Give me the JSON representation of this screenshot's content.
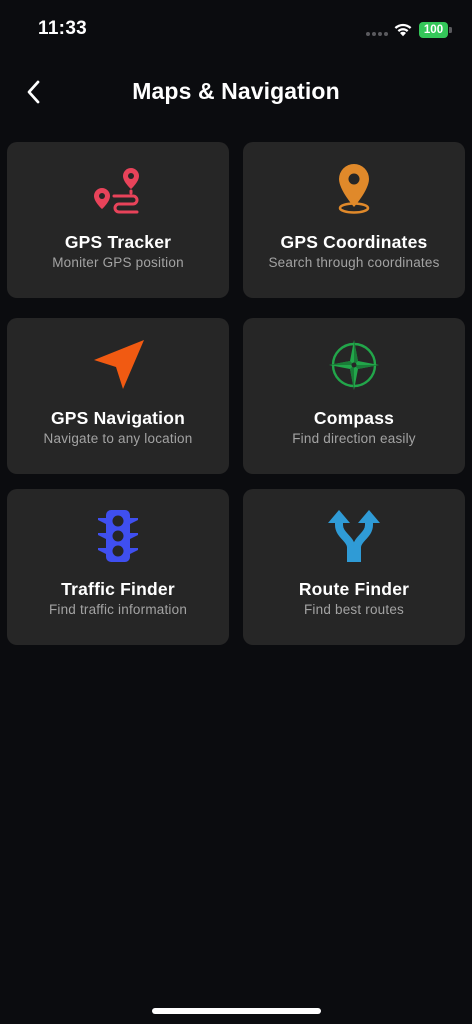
{
  "status_bar": {
    "time": "11:33",
    "battery_level": "100",
    "battery_color": "#34c759"
  },
  "header": {
    "title": "Maps & Navigation",
    "back_icon": "chevron-left-icon"
  },
  "cards": [
    {
      "title": "GPS Tracker",
      "subtitle": "Moniter GPS position",
      "icon": "route-pins-icon",
      "icon_color": "#e8435a"
    },
    {
      "title": "GPS Coordinates",
      "subtitle": "Search through coordinates",
      "icon": "location-pin-icon",
      "icon_color": "#e0892a"
    },
    {
      "title": "GPS Navigation",
      "subtitle": "Navigate to any location",
      "icon": "navigation-arrow-icon",
      "icon_color": "#f15a12"
    },
    {
      "title": "Compass",
      "subtitle": "Find direction easily",
      "icon": "compass-icon",
      "icon_color": "#22a64a"
    },
    {
      "title": "Traffic Finder",
      "subtitle": "Find traffic information",
      "icon": "traffic-light-icon",
      "icon_color": "#3f4ff0"
    },
    {
      "title": "Route Finder",
      "subtitle": "Find best routes",
      "icon": "route-split-icon",
      "icon_color": "#2f9bd6"
    }
  ],
  "colors": {
    "background": "#0b0c0f",
    "card_background": "#262626",
    "subtitle": "#a3a3a3"
  }
}
